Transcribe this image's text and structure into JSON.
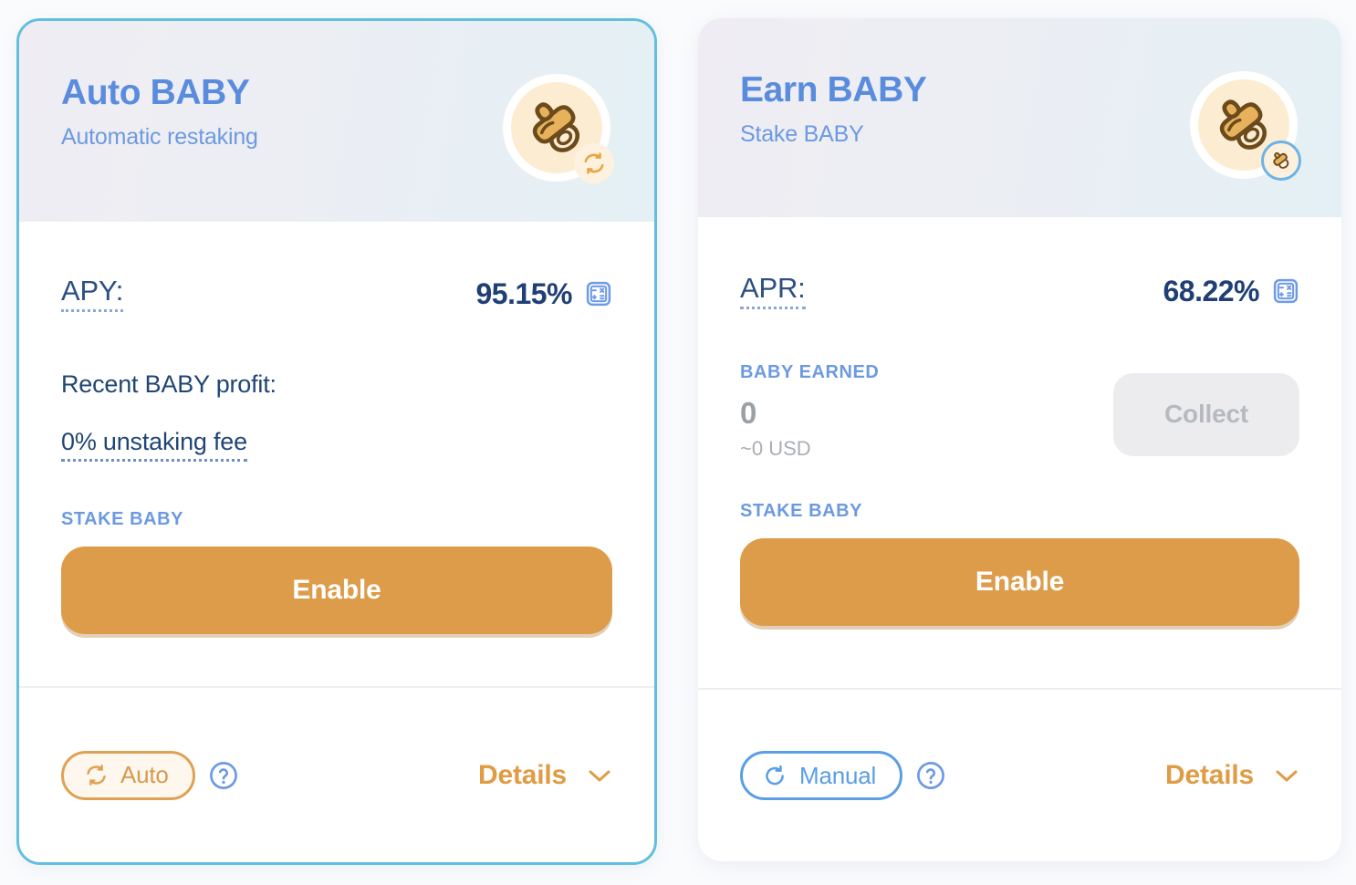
{
  "background_color": "#fafbfd",
  "cards": [
    {
      "id": "auto-baby",
      "border_color": "#62bfe0",
      "title": "Auto BABY",
      "subtitle": "Automatic restaking",
      "icon": {
        "name": "pacifier-icon",
        "badge": "refresh-badge-icon"
      },
      "rate": {
        "label": "APY:",
        "value": "95.15%",
        "calculator_icon": "calculator-icon"
      },
      "profit_label": "Recent BABY profit:",
      "fee_link": "0% unstaking fee",
      "stake": {
        "label": "STAKE BABY",
        "button": "Enable",
        "button_color": "#dd9c49"
      },
      "footer": {
        "mode": "Auto",
        "mode_icon": "auto-refresh-icon",
        "mode_color": "#dfa254",
        "help_icon": "help-circle-icon",
        "details": "Details",
        "details_icon": "chevron-down-icon",
        "details_color": "#df9c45"
      }
    },
    {
      "id": "earn-baby",
      "border_color": "none",
      "title": "Earn BABY",
      "subtitle": "Stake BABY",
      "icon": {
        "name": "pacifier-icon",
        "badge": "pacifier-badge-icon"
      },
      "rate": {
        "label": "APR:",
        "value": "68.22%",
        "calculator_icon": "calculator-icon"
      },
      "earned": {
        "label": "BABY EARNED",
        "amount": "0",
        "usd": "~0 USD",
        "collect_button": "Collect",
        "collect_disabled": true
      },
      "stake": {
        "label": "STAKE BABY",
        "button": "Enable",
        "button_color": "#dd9c49"
      },
      "footer": {
        "mode": "Manual",
        "mode_icon": "manual-refresh-icon",
        "mode_color": "#5a9ee4",
        "help_icon": "help-circle-icon",
        "details": "Details",
        "details_icon": "chevron-down-icon",
        "details_color": "#df9c45"
      }
    }
  ]
}
